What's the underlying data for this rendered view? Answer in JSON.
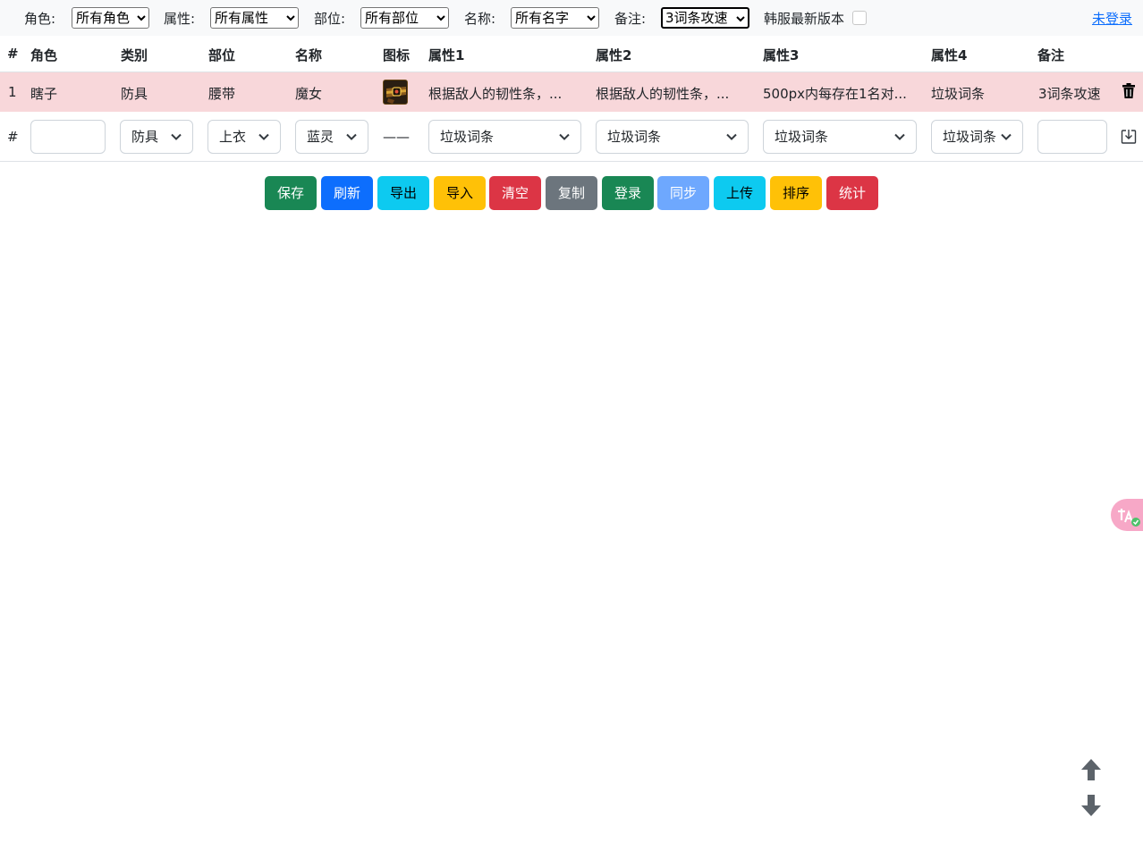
{
  "filters": {
    "role_label": "角色:",
    "role_value": "所有角色",
    "attr_label": "属性:",
    "attr_value": "所有属性",
    "part_label": "部位:",
    "part_value": "所有部位",
    "name_label": "名称:",
    "name_value": "所有名字",
    "note_label": "备注:",
    "note_value": "3词条攻速",
    "version_label": "韩服最新版本",
    "version_checked": false,
    "login_link": "未登录"
  },
  "table": {
    "headers": [
      "#",
      "角色",
      "类别",
      "部位",
      "名称",
      "图标",
      "属性1",
      "属性2",
      "属性3",
      "属性4",
      "备注"
    ],
    "rows": [
      {
        "index": "1",
        "role": "瞎子",
        "category": "防具",
        "part": "腰带",
        "name": "魔女",
        "icon": "belt-item-icon",
        "attr1": "根据敌人的韧性条，...",
        "attr2": "根据敌人的韧性条，...",
        "attr3": "500px内每存在1名对...",
        "attr4": "垃圾词条",
        "note": "3词条攻速"
      }
    ],
    "new_row": {
      "index": "#",
      "role": "",
      "category": "防具",
      "part": "上衣",
      "name": "蓝灵",
      "icon": "——",
      "attr1": "垃圾词条",
      "attr2": "垃圾词条",
      "attr3": "垃圾词条",
      "attr4": "垃圾词条",
      "note": ""
    }
  },
  "buttons": [
    {
      "label": "保存",
      "color": "#198754"
    },
    {
      "label": "刷新",
      "color": "#0d6efd"
    },
    {
      "label": "导出",
      "color": "#0dcaf0"
    },
    {
      "label": "导入",
      "color": "#ffc107"
    },
    {
      "label": "清空",
      "color": "#dc3545"
    },
    {
      "label": "复制",
      "color": "#6c757d"
    },
    {
      "label": "登录",
      "color": "#198754"
    },
    {
      "label": "同步",
      "color": "#6ea8fe"
    },
    {
      "label": "上传",
      "color": "#0dcaf0"
    },
    {
      "label": "排序",
      "color": "#ffc107"
    },
    {
      "label": "统计",
      "color": "#dc3545"
    }
  ],
  "colors": {
    "highlight_row": "#f8d7da",
    "link": "#0d6efd",
    "arrow": "#5c636a"
  }
}
